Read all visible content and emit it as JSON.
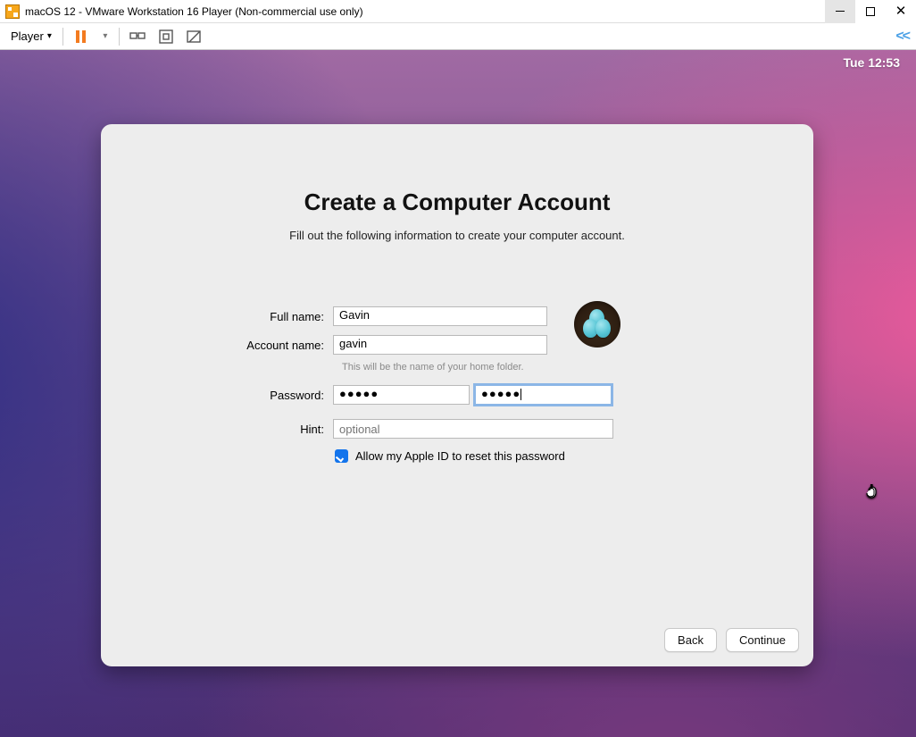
{
  "window": {
    "title": "macOS 12 - VMware Workstation 16 Player (Non-commercial use only)"
  },
  "toolbar": {
    "player_label": "Player"
  },
  "menubar": {
    "clock": "Tue 12:53"
  },
  "setup": {
    "heading": "Create a Computer Account",
    "subheading": "Fill out the following information to create your computer account.",
    "labels": {
      "full_name": "Full name:",
      "account_name": "Account name:",
      "password": "Password:",
      "hint": "Hint:"
    },
    "values": {
      "full_name": "Gavin",
      "account_name": "gavin",
      "password": "●●●●●",
      "password_verify": "●●●●●"
    },
    "account_name_note": "This will be the name of your home folder.",
    "hint_placeholder": "optional",
    "allow_apple_id_label": "Allow my Apple ID to reset this password",
    "allow_apple_id_checked": true,
    "buttons": {
      "back": "Back",
      "continue": "Continue"
    }
  }
}
